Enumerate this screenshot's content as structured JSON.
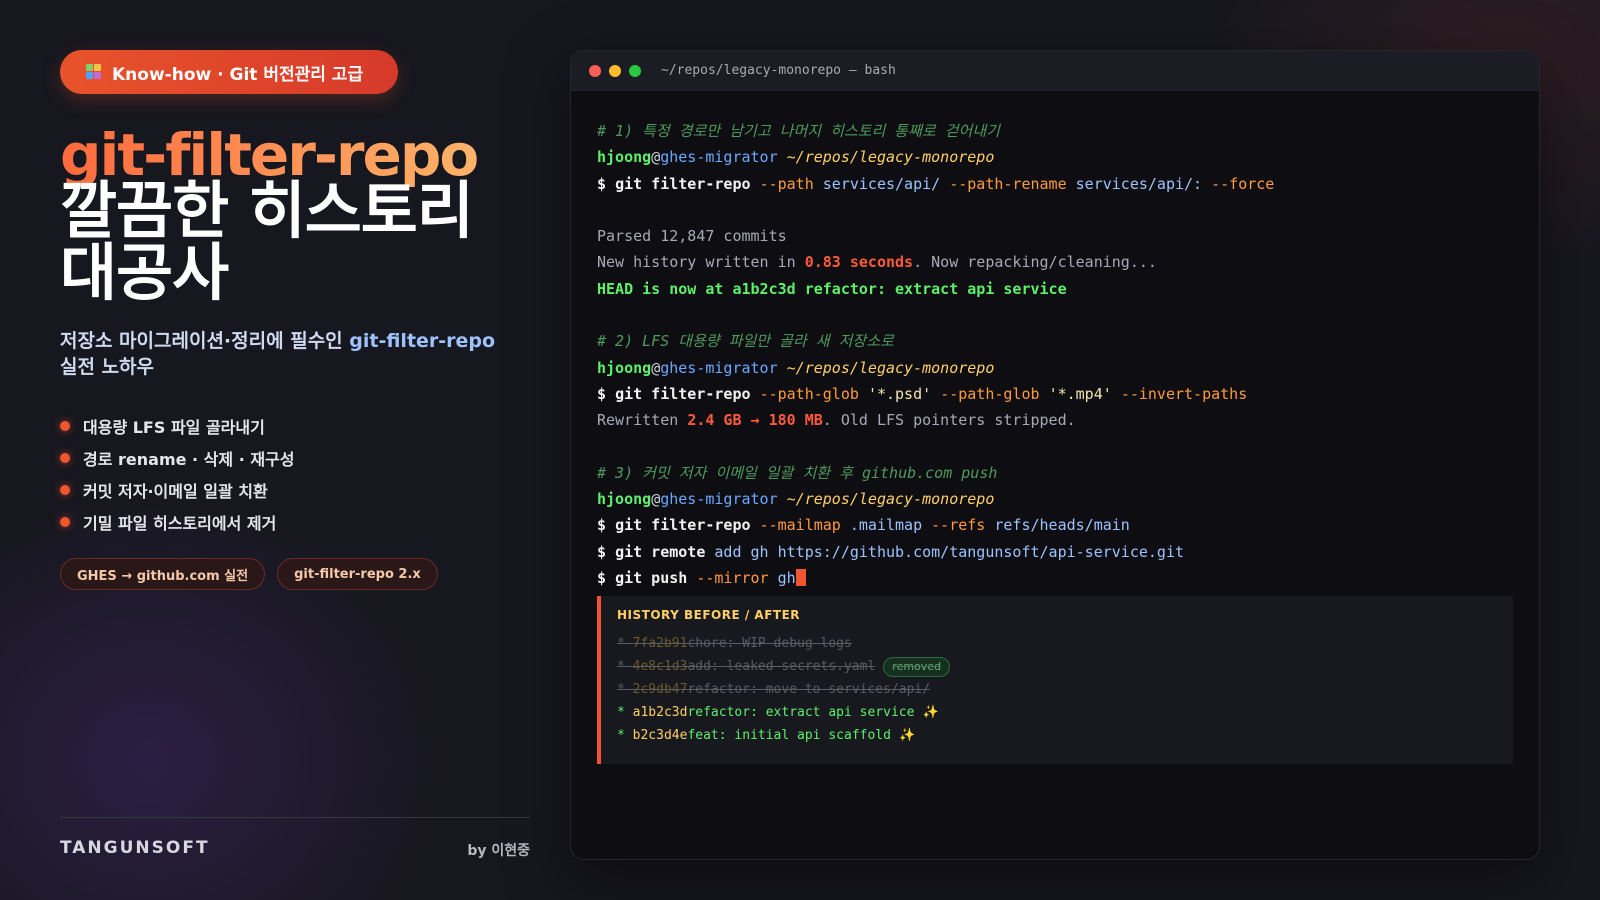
{
  "badge": {
    "icon": "git-branch-icon",
    "label": "Know-how · Git 버전관리 고급"
  },
  "hero": {
    "title_main": "git-filter-repo",
    "title_line1": "깔끔한 히스토리",
    "title_line2": "대공사",
    "subtitle_prefix": "저장소 마이그레이션·정리에 필수인 ",
    "subtitle_highlight": "git-filter-repo",
    "subtitle_suffix": "실전 노하우"
  },
  "bullets": [
    "대용량 LFS 파일 골라내기",
    "경로 rename · 삭제 · 재구성",
    "커밋 저자·이메일 일괄 치환",
    "기밀 파일 히스토리에서 제거"
  ],
  "chips": [
    "GHES → github.com 실전",
    "git-filter-repo 2.x"
  ],
  "footer": {
    "brand": "TANGUNSOFT",
    "byline": "by 이현중"
  },
  "colors": {
    "accent": "#f0552f",
    "background": "#17171f",
    "terminal_bg": "#0e0e12"
  },
  "terminal": {
    "title": "~/repos/legacy-monorepo — bash",
    "user": "hjoong",
    "host": "ghes-migrator",
    "path": "~/repos/legacy-monorepo",
    "prompt": "$",
    "comment1": "# 1) 특정 경로만 남기고 나머지 히스토리 통째로 걷어내기",
    "cmd1": {
      "cmd": "git filter-repo",
      "flag1": "--path",
      "arg1": "services/api/",
      "flag2": "--path-rename",
      "arg2": "services/api/:",
      "flag3": "--force"
    },
    "out1_1": "Parsed 12,847 commits",
    "out1_2_pre": "New history written in ",
    "out1_2_num": "0.83 seconds",
    "out1_2_post": ". Now repacking/cleaning...",
    "out1_3": "HEAD is now at a1b2c3d refactor: extract api service",
    "comment2": "# 2) LFS 대용량 파일만 골라 새 저장소로",
    "cmd2": {
      "cmd": "git filter-repo",
      "flag1": "--path-glob",
      "str1": "'*.psd'",
      "flag2": "--path-glob",
      "str2": "'*.mp4'",
      "flag3": "--invert-paths"
    },
    "out2_pre": "Rewritten ",
    "out2_num": "2.4 GB → 180 MB",
    "out2_post": ". Old LFS pointers stripped.",
    "comment3": "# 3) 커밋 저자 이메일 일괄 치환 후 github.com push",
    "cmd3": {
      "cmd": "git filter-repo",
      "flag1": "--mailmap",
      "arg1": ".mailmap",
      "flag2": "--refs",
      "arg2": "refs/heads/main"
    },
    "cmd4": {
      "cmd": "git remote",
      "arg1": "add gh",
      "arg2": "https://github.com/tangunsoft/api-service.git"
    },
    "cmd5": {
      "cmd": "git push",
      "flag1": "--mirror",
      "arg1": "gh"
    }
  },
  "history": {
    "title": "HISTORY BEFORE / AFTER",
    "removed_label": "removed",
    "old": [
      {
        "hash": "7fa2b91",
        "msg": "chore: WIP debug logs"
      },
      {
        "hash": "4e8c1d3",
        "msg": "add: leaked-secrets.yaml"
      },
      {
        "hash": "2c9db47",
        "msg": "refactor: move to services/api/"
      }
    ],
    "new": [
      {
        "hash": "a1b2c3d",
        "msg": "refactor: extract api service",
        "mark": "✨"
      },
      {
        "hash": "b2c3d4e",
        "msg": "feat: initial api scaffold",
        "mark": "✨"
      }
    ]
  }
}
